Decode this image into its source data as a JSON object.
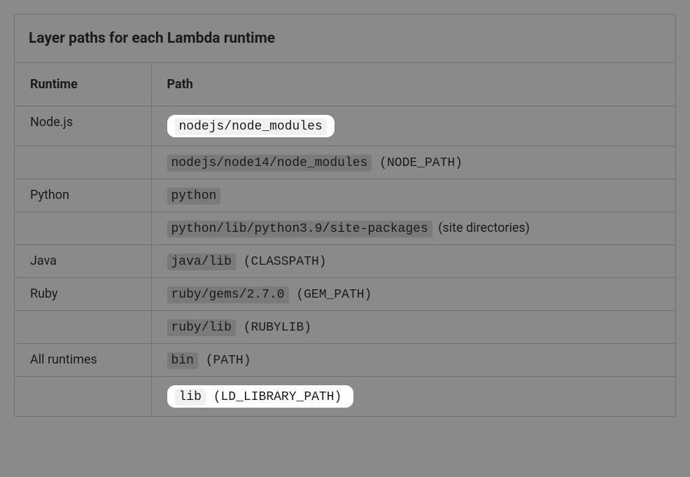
{
  "caption": "Layer paths for each Lambda runtime",
  "headers": {
    "runtime": "Runtime",
    "path": "Path"
  },
  "rows": [
    {
      "runtime": "Node.js",
      "path_code": "nodejs/node_modules",
      "path_suffix": "",
      "highlighted": true
    },
    {
      "runtime": "",
      "path_code": "nodejs/node14/node_modules",
      "path_suffix": "(NODE_PATH)",
      "highlighted": false,
      "suffix_mono": true
    },
    {
      "runtime": "Python",
      "path_code": "python",
      "path_suffix": "",
      "highlighted": false
    },
    {
      "runtime": "",
      "path_code": "python/lib/python3.9/site-packages",
      "path_suffix": "(site directories)",
      "highlighted": false,
      "suffix_mono": false
    },
    {
      "runtime": "Java",
      "path_code": "java/lib",
      "path_suffix": "(CLASSPATH)",
      "highlighted": false,
      "suffix_mono": true
    },
    {
      "runtime": "Ruby",
      "path_code": "ruby/gems/2.7.0",
      "path_suffix": "(GEM_PATH)",
      "highlighted": false,
      "suffix_mono": true
    },
    {
      "runtime": "",
      "path_code": "ruby/lib",
      "path_suffix": "(RUBYLIB)",
      "highlighted": false,
      "suffix_mono": true
    },
    {
      "runtime": "All runtimes",
      "path_code": "bin",
      "path_suffix": "(PATH)",
      "highlighted": false,
      "suffix_mono": true
    },
    {
      "runtime": "",
      "path_code": "lib",
      "path_suffix": "(LD_LIBRARY_PATH)",
      "highlighted": true,
      "suffix_mono": true
    }
  ]
}
